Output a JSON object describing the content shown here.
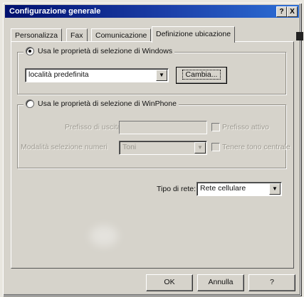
{
  "window": {
    "title": "Configurazione generale",
    "help_btn": "?",
    "close_btn": "X"
  },
  "tabs": [
    {
      "label": "Personalizza"
    },
    {
      "label": "Fax"
    },
    {
      "label": "Comunicazione"
    },
    {
      "label": "Definizione ubicazione",
      "active": true
    }
  ],
  "windows_group": {
    "radio_label": "Usa le proprietà di selezione di Windows",
    "selected": true,
    "location_value": "località predefinita",
    "modify_button": "Cambia..."
  },
  "winphone_group": {
    "radio_label": "Usa le proprietà di selezione di WinPhone",
    "selected": false,
    "prefix_label": "Prefisso di uscita",
    "prefix_checkbox_label": "Prefisso attivo",
    "dial_mode_label": "Modalità selezione numeri",
    "dial_mode_value": "Toni",
    "tone_checkbox_label": "Tenere tono centrale"
  },
  "network": {
    "label": "Tipo di rete:",
    "value": "Rete cellulare"
  },
  "footer": {
    "ok": "OK",
    "cancel": "Annulla",
    "help": "?"
  },
  "colors": {
    "titlebar_start": "#00106e",
    "titlebar_end": "#2d6fd6",
    "face": "#d6d3cb"
  }
}
